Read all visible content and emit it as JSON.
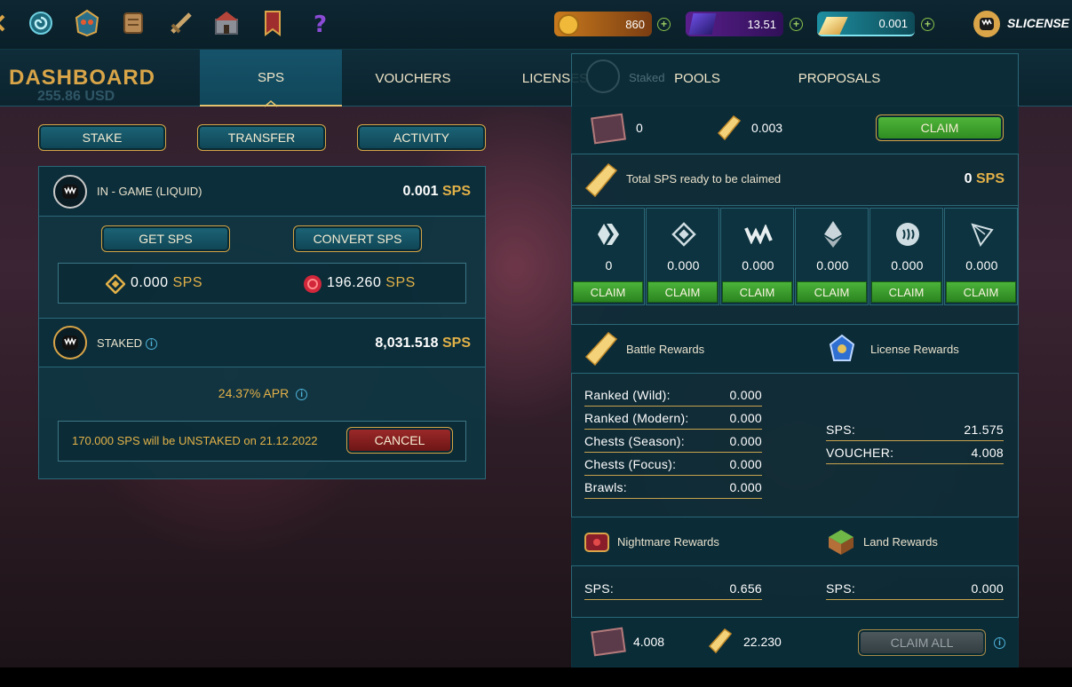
{
  "topbar": {
    "icons": [
      "home-swirl-icon",
      "battle-mask-icon",
      "scroll-icon",
      "sword-icon",
      "guild-castle-icon",
      "banner-icon",
      "question-icon"
    ],
    "dec": {
      "value": "860"
    },
    "credits": {
      "value": "13.51"
    },
    "sps": {
      "value": "0.001"
    },
    "user": {
      "name": "SLICENSE"
    }
  },
  "header": {
    "title": "DASHBOARD",
    "ghost_usd": "255.86 USD",
    "tabs": [
      {
        "label": "SPS"
      },
      {
        "label": "VOUCHERS"
      },
      {
        "label": "LICENSES"
      },
      {
        "label": "POOLS"
      },
      {
        "label": "PROPOSALS"
      }
    ],
    "ghost_staked": "Staked"
  },
  "actions": {
    "stake": "STAKE",
    "transfer": "TRANSFER",
    "activity": "ACTIVITY"
  },
  "ingame": {
    "label": "IN - GAME (LIQUID)",
    "amount": "0.001",
    "unit": "SPS",
    "get_sps": "GET SPS",
    "convert_sps": "CONVERT SPS",
    "bsc_amount": "0.000",
    "eth_amount": "196.260",
    "unit_small": "SPS"
  },
  "staked": {
    "label": "STAKED",
    "amount": "8,031.518",
    "unit": "SPS",
    "apr": "24.37% APR",
    "unstake_msg": "170.000 SPS will be UNSTAKED on 21.12.2022",
    "cancel": "CANCEL"
  },
  "airdrop": {
    "cards": "0",
    "sps": "0.003",
    "claim": "CLAIM",
    "total_label": "Total SPS ready to be claimed",
    "total_value": "0",
    "total_unit": "SPS"
  },
  "chains": [
    {
      "icon": "hive-icon",
      "value": "0",
      "claim": "CLAIM"
    },
    {
      "icon": "binance-icon",
      "value": "0.000",
      "claim": "CLAIM"
    },
    {
      "icon": "wax-icon",
      "value": "0.000",
      "claim": "CLAIM"
    },
    {
      "icon": "ethereum-icon",
      "value": "0.000",
      "claim": "CLAIM"
    },
    {
      "icon": "steem-icon",
      "value": "0.000",
      "claim": "CLAIM"
    },
    {
      "icon": "tron-icon",
      "value": "0.000",
      "claim": "CLAIM"
    }
  ],
  "battle": {
    "title": "Battle Rewards",
    "rows": [
      {
        "label": "Ranked (Wild):",
        "value": "0.000"
      },
      {
        "label": "Ranked (Modern):",
        "value": "0.000"
      },
      {
        "label": "Chests (Season):",
        "value": "0.000"
      },
      {
        "label": "Chests (Focus):",
        "value": "0.000"
      },
      {
        "label": "Brawls:",
        "value": "0.000"
      }
    ]
  },
  "license": {
    "title": "License Rewards",
    "rows": [
      {
        "label": "SPS:",
        "value": "21.575"
      },
      {
        "label": "VOUCHER:",
        "value": "4.008"
      }
    ]
  },
  "nightmare": {
    "title": "Nightmare Rewards",
    "label": "SPS:",
    "value": "0.656"
  },
  "land": {
    "title": "Land Rewards",
    "label": "SPS:",
    "value": "0.000"
  },
  "footer": {
    "vouchers": "4.008",
    "sps": "22.230",
    "claim_all": "CLAIM ALL"
  },
  "colors": {
    "gold": "#e2b148",
    "panel": "#0e3642",
    "green": "#4bb33a",
    "cancel": "#8a1f1f",
    "accent_line": "#e3c26f"
  }
}
